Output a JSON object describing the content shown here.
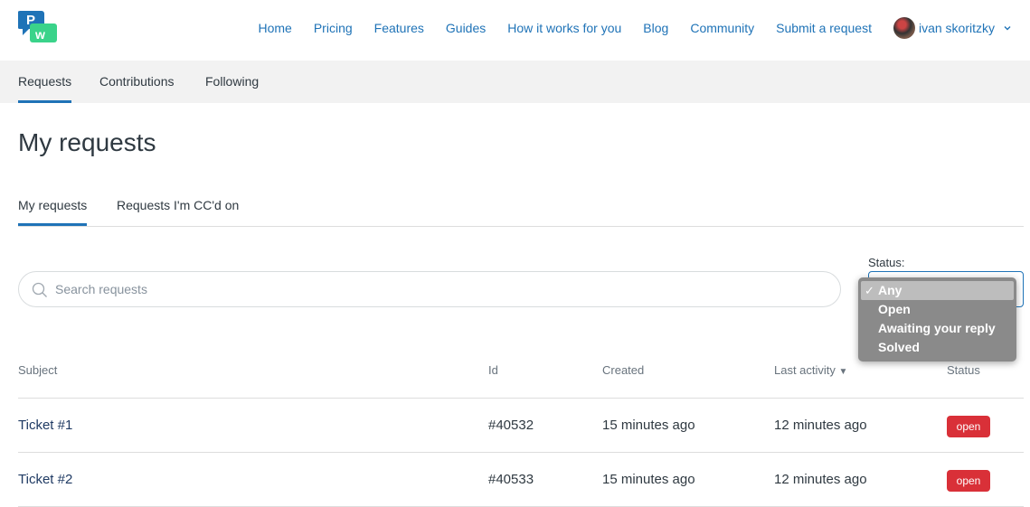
{
  "header": {
    "nav": [
      "Home",
      "Pricing",
      "Features",
      "Guides",
      "How it works for you",
      "Blog",
      "Community",
      "Submit a request"
    ],
    "user_name": "ivan skoritzky"
  },
  "subnav": {
    "items": [
      "Requests",
      "Contributions",
      "Following"
    ]
  },
  "page": {
    "title": "My requests"
  },
  "tabs": [
    "My requests",
    "Requests I'm CC'd on"
  ],
  "search": {
    "placeholder": "Search requests"
  },
  "status_filter": {
    "label": "Status:",
    "options": [
      "Any",
      "Open",
      "Awaiting your reply",
      "Solved"
    ],
    "selected": "Any",
    "check_glyph": "✓"
  },
  "table": {
    "headers": [
      "Subject",
      "Id",
      "Created",
      "Last activity",
      "Status"
    ],
    "sort_indicator": "▼",
    "rows": [
      {
        "subject": "Ticket #1",
        "id": "#40532",
        "created": "15 minutes ago",
        "last_activity": "12 minutes ago",
        "status": "open"
      },
      {
        "subject": "Ticket #2",
        "id": "#40533",
        "created": "15 minutes ago",
        "last_activity": "12 minutes ago",
        "status": "open"
      }
    ]
  },
  "colors": {
    "accent": "#1f73b7",
    "badge_open": "#d93038",
    "logo_blue": "#1f73b7",
    "logo_green": "#3ad38a"
  },
  "icons": [
    "logo-icon",
    "search-icon",
    "chevron-down-icon",
    "avatar"
  ]
}
